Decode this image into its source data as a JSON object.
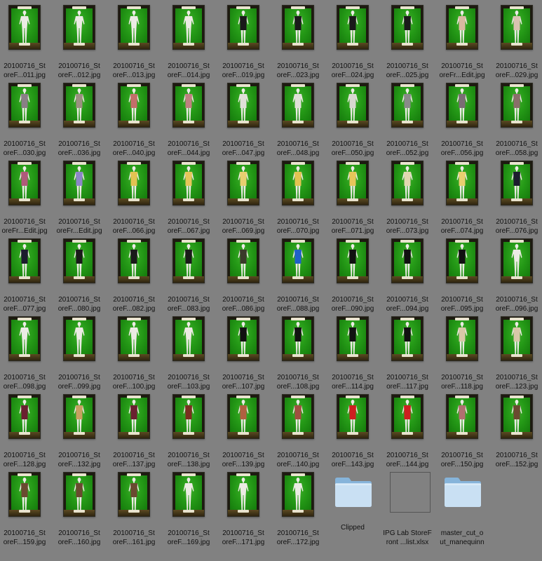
{
  "window": {
    "background": "#818181"
  },
  "files": [
    {
      "l1": "20100716_St",
      "l2": "oreF...011.jpg",
      "cloth": "none"
    },
    {
      "l1": "20100716_St",
      "l2": "oreF...012.jpg",
      "cloth": "none"
    },
    {
      "l1": "20100716_St",
      "l2": "oreF...013.jpg",
      "cloth": "none"
    },
    {
      "l1": "20100716_St",
      "l2": "oreF...014.jpg",
      "cloth": "none"
    },
    {
      "l1": "20100716_St",
      "l2": "oreF...019.jpg",
      "cloth": "#1a1a1a"
    },
    {
      "l1": "20100716_St",
      "l2": "oreF...023.jpg",
      "cloth": "#1a1a1a"
    },
    {
      "l1": "20100716_St",
      "l2": "oreF...024.jpg",
      "cloth": "#1a1a1a"
    },
    {
      "l1": "20100716_St",
      "l2": "oreF...025.jpg",
      "cloth": "#1a1a1a"
    },
    {
      "l1": "20100716_St",
      "l2": "oreFr...Edit.jpg",
      "cloth": "#d9b9a0"
    },
    {
      "l1": "20100716_St",
      "l2": "oreF...029.jpg",
      "cloth": "#d9c3b0"
    },
    {
      "l1": "20100716_St",
      "l2": "oreF...030.jpg",
      "cloth": "#8a7f86"
    },
    {
      "l1": "20100716_St",
      "l2": "oreF...036.jpg",
      "cloth": "#9b8f80"
    },
    {
      "l1": "20100716_St",
      "l2": "oreF...040.jpg",
      "cloth": "#c46e6a"
    },
    {
      "l1": "20100716_St",
      "l2": "oreF...044.jpg",
      "cloth": "#c08080"
    },
    {
      "l1": "20100716_St",
      "l2": "oreF...047.jpg",
      "cloth": "#e0e0d8"
    },
    {
      "l1": "20100716_St",
      "l2": "oreF...048.jpg",
      "cloth": "#e0e0d8"
    },
    {
      "l1": "20100716_St",
      "l2": "oreF...050.jpg",
      "cloth": "#d8d8d0"
    },
    {
      "l1": "20100716_St",
      "l2": "oreF...052.jpg",
      "cloth": "#8a8a8a"
    },
    {
      "l1": "20100716_St",
      "l2": "oreF...056.jpg",
      "cloth": "#7a6d74"
    },
    {
      "l1": "20100716_St",
      "l2": "oreF...058.jpg",
      "cloth": "#8a6f6a"
    },
    {
      "l1": "20100716_St",
      "l2": "oreFr...Edit.jpg",
      "cloth": "#b05a7a"
    },
    {
      "l1": "20100716_St",
      "l2": "oreFr...Edit.jpg",
      "cloth": "#8c86c8"
    },
    {
      "l1": "20100716_St",
      "l2": "oreF...066.jpg",
      "cloth": "#e3c352"
    },
    {
      "l1": "20100716_St",
      "l2": "oreF...067.jpg",
      "cloth": "#e6c65a"
    },
    {
      "l1": "20100716_St",
      "l2": "oreF...069.jpg",
      "cloth": "#e8cf70"
    },
    {
      "l1": "20100716_St",
      "l2": "oreF...070.jpg",
      "cloth": "#e3c352"
    },
    {
      "l1": "20100716_St",
      "l2": "oreF...071.jpg",
      "cloth": "#e6c65a"
    },
    {
      "l1": "20100716_St",
      "l2": "oreF...073.jpg",
      "cloth": "#e2d7b0"
    },
    {
      "l1": "20100716_St",
      "l2": "oreF...074.jpg",
      "cloth": "#e8cf70"
    },
    {
      "l1": "20100716_St",
      "l2": "oreF...076.jpg",
      "cloth": "#1c1c2e"
    },
    {
      "l1": "20100716_St",
      "l2": "oreF...077.jpg",
      "cloth": "#1c1c2e"
    },
    {
      "l1": "20100716_St",
      "l2": "oreF...080.jpg",
      "cloth": "#1a1a1a"
    },
    {
      "l1": "20100716_St",
      "l2": "oreF...082.jpg",
      "cloth": "#1a1a1a"
    },
    {
      "l1": "20100716_St",
      "l2": "oreF...083.jpg",
      "cloth": "#1a1a1a"
    },
    {
      "l1": "20100716_St",
      "l2": "oreF...086.jpg",
      "cloth": "#3a3a2a"
    },
    {
      "l1": "20100716_St",
      "l2": "oreF...088.jpg",
      "cloth": "#2060c8"
    },
    {
      "l1": "20100716_St",
      "l2": "oreF...090.jpg",
      "cloth": "#111111"
    },
    {
      "l1": "20100716_St",
      "l2": "oreF...094.jpg",
      "cloth": "#111111"
    },
    {
      "l1": "20100716_St",
      "l2": "oreF...095.jpg",
      "cloth": "#111111"
    },
    {
      "l1": "20100716_St",
      "l2": "oreF...096.jpg",
      "cloth": "none"
    },
    {
      "l1": "20100716_St",
      "l2": "oreF...098.jpg",
      "cloth": "none"
    },
    {
      "l1": "20100716_St",
      "l2": "oreF...099.jpg",
      "cloth": "none"
    },
    {
      "l1": "20100716_St",
      "l2": "oreF...100.jpg",
      "cloth": "none"
    },
    {
      "l1": "20100716_St",
      "l2": "oreF...103.jpg",
      "cloth": "none"
    },
    {
      "l1": "20100716_St",
      "l2": "oreF...107.jpg",
      "cloth": "#111111"
    },
    {
      "l1": "20100716_St",
      "l2": "oreF...108.jpg",
      "cloth": "#111111"
    },
    {
      "l1": "20100716_St",
      "l2": "oreF...114.jpg",
      "cloth": "#111111"
    },
    {
      "l1": "20100716_St",
      "l2": "oreF...117.jpg",
      "cloth": "#111111"
    },
    {
      "l1": "20100716_St",
      "l2": "oreF...118.jpg",
      "cloth": "#d8c8a8"
    },
    {
      "l1": "20100716_St",
      "l2": "oreF...123.jpg",
      "cloth": "#d8c8a8"
    },
    {
      "l1": "20100716_St",
      "l2": "oreF...128.jpg",
      "cloth": "#6a2030"
    },
    {
      "l1": "20100716_St",
      "l2": "oreF...132.jpg",
      "cloth": "#c8a060"
    },
    {
      "l1": "20100716_St",
      "l2": "oreF...137.jpg",
      "cloth": "#6a2030"
    },
    {
      "l1": "20100716_St",
      "l2": "oreF...138.jpg",
      "cloth": "#7a3020"
    },
    {
      "l1": "20100716_St",
      "l2": "oreF...139.jpg",
      "cloth": "#b06040"
    },
    {
      "l1": "20100716_St",
      "l2": "oreF...140.jpg",
      "cloth": "#a05040"
    },
    {
      "l1": "20100716_St",
      "l2": "oreF...143.jpg",
      "cloth": "#cc2020"
    },
    {
      "l1": "20100716_St",
      "l2": "oreF...144.jpg",
      "cloth": "#cc2020"
    },
    {
      "l1": "20100716_St",
      "l2": "oreF...150.jpg",
      "cloth": "#b07070"
    },
    {
      "l1": "20100716_St",
      "l2": "oreF...152.jpg",
      "cloth": "#6a4a30"
    },
    {
      "l1": "20100716_St",
      "l2": "oreF...159.jpg",
      "cloth": "#6a4a30"
    },
    {
      "l1": "20100716_St",
      "l2": "oreF...160.jpg",
      "cloth": "#6a4a30"
    },
    {
      "l1": "20100716_St",
      "l2": "oreF...161.jpg",
      "cloth": "#6a4a30"
    },
    {
      "l1": "20100716_St",
      "l2": "oreF...169.jpg",
      "cloth": "none"
    },
    {
      "l1": "20100716_St",
      "l2": "oreF...171.jpg",
      "cloth": "none"
    },
    {
      "l1": "20100716_St",
      "l2": "oreF...172.jpg",
      "cloth": "none"
    }
  ],
  "folders_and_docs": [
    {
      "kind": "folder",
      "l1": "Clipped",
      "l2": ""
    },
    {
      "kind": "doc",
      "l1": "IPG Lab StoreF",
      "l2": "ront ...list.xlsx"
    },
    {
      "kind": "folder",
      "l1": "master_cut_o",
      "l2": "ut_manequinn"
    }
  ],
  "icons": {
    "image_file": "jpg-thumbnail-icon",
    "folder": "folder-icon",
    "spreadsheet": "xlsx-document-icon"
  },
  "colors": {
    "folder_light": "#c9e0f3",
    "folder_dark": "#86b4da",
    "caption_text": "#111111"
  }
}
